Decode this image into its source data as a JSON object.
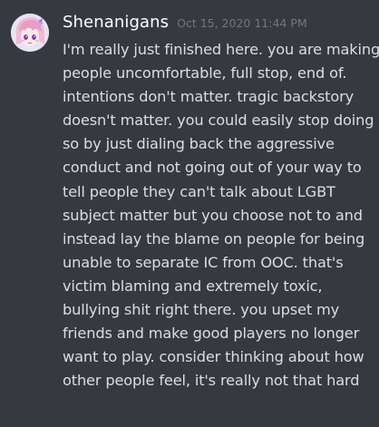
{
  "message": {
    "author": "Shenanigans",
    "timestamp": "Oct 15, 2020 11:44 PM",
    "avatar_icon": "anime-character-avatar",
    "lines": [
      "I'm really just finished here. you are making",
      "people uncomfortable, full stop, end of.",
      "intentions don't matter. tragic backstory",
      "doesn't matter. you could easily stop doing",
      "so by just dialing back the aggressive",
      "conduct and not going out of your way to",
      "tell people they can't talk about LGBT",
      "subject matter but you choose not to and",
      "instead lay the blame on people for being",
      "unable to separate IC from OOC. that's",
      "victim blaming and extremely toxic,",
      "bullying shit right there. you upset my",
      "friends and make good players no longer",
      "want to play. consider thinking about how",
      "other people feel, it's really not that hard"
    ]
  },
  "colors": {
    "background": "#36393f",
    "username": "#ffffff",
    "timestamp": "#72767d",
    "text": "#dcddde"
  }
}
